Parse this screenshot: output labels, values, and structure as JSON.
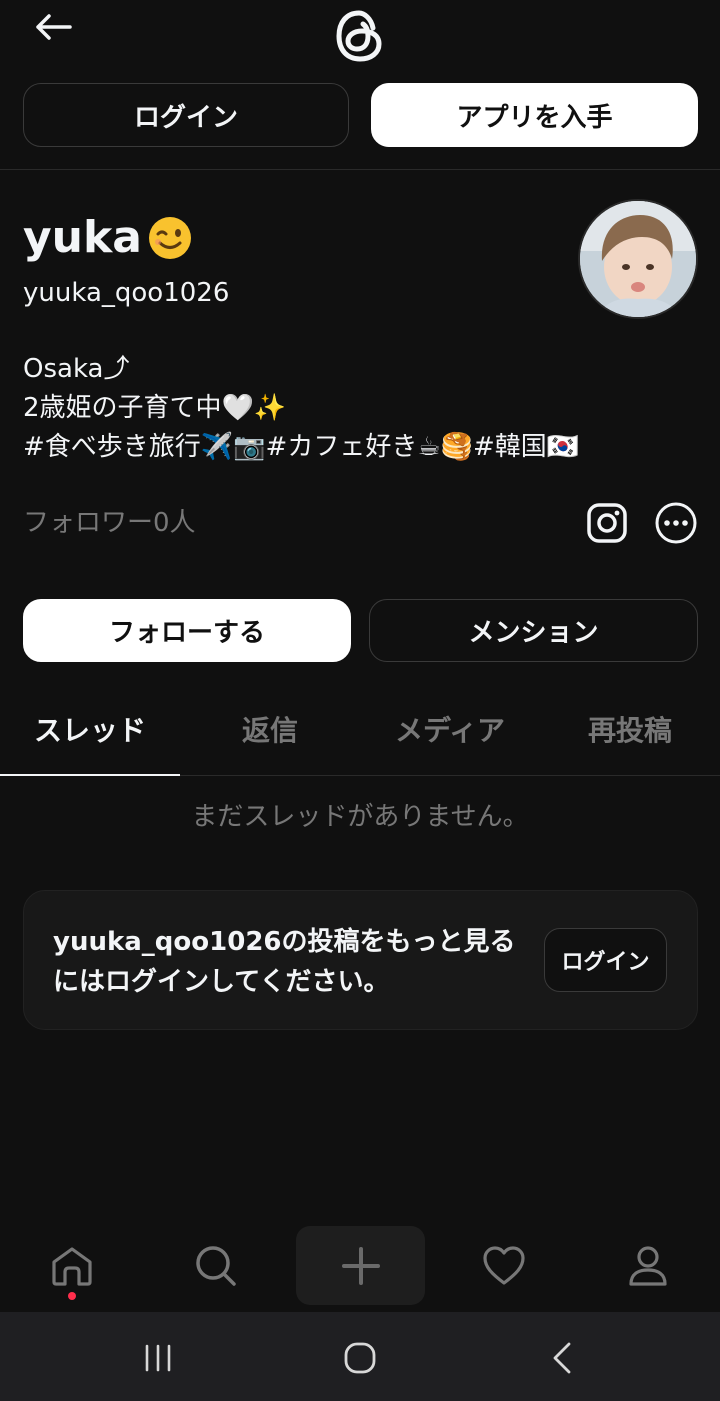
{
  "header": {
    "login_label": "ログイン",
    "get_app_label": "アプリを入手"
  },
  "profile": {
    "display_name": "yuka",
    "username": "yuuka_qoo1026",
    "bio": "Osaka⤴\n2歳姫の子育て中🤍✨\n#食べ歩き旅行✈️📷#カフェ好き☕🥞#韓国🇰🇷",
    "followers": "フォロワー0人",
    "follow_label": "フォローする",
    "mention_label": "メンション"
  },
  "tabs": [
    {
      "label": "スレッド",
      "active": true
    },
    {
      "label": "返信",
      "active": false
    },
    {
      "label": "メディア",
      "active": false
    },
    {
      "label": "再投稿",
      "active": false
    }
  ],
  "empty_message": "まだスレッドがありません。",
  "login_card": {
    "text": "yuuka_qoo1026の投稿をもっと見るにはログインしてください。",
    "login_label": "ログイン"
  },
  "icons": {
    "back": "arrow-left-icon",
    "logo": "threads-logo-icon",
    "instagram": "instagram-icon",
    "more": "more-icon",
    "home": "home-icon",
    "search": "search-icon",
    "create": "plus-icon",
    "activity": "heart-icon",
    "profile": "person-icon"
  },
  "colors": {
    "background": "#101010",
    "text_primary": "#f3f5f7",
    "text_secondary": "#777777",
    "notification": "#ff2e4c"
  }
}
